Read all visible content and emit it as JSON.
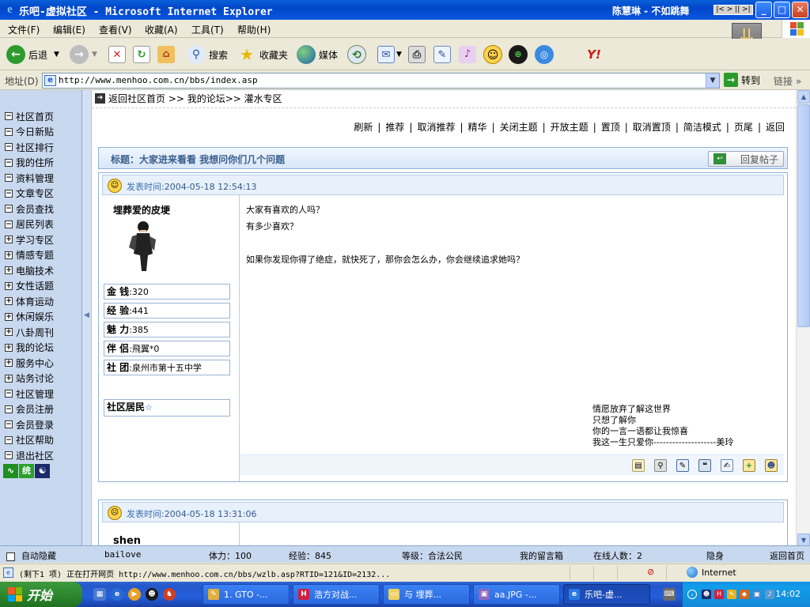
{
  "window": {
    "title": "乐吧-虚拟社区 - Microsoft Internet Explorer",
    "ticker": "陈慧琳 - 不如跳舞",
    "ticker_controls": "|< > || >|",
    "min": "_",
    "max": "□",
    "close": "✕"
  },
  "menu": [
    "文件(F)",
    "编辑(E)",
    "查看(V)",
    "收藏(A)",
    "工具(T)",
    "帮助(H)"
  ],
  "toolbar": {
    "back": "后退",
    "search": "搜索",
    "favorites": "收藏夹",
    "media": "媒体"
  },
  "address": {
    "label": "地址(D)",
    "url": "http://www.menhoo.com.cn/bbs/index.asp",
    "go": "转到",
    "links": "链接"
  },
  "sidebar": {
    "items": [
      {
        "label": "社区首页",
        "expander": "−"
      },
      {
        "label": "今日新贴",
        "expander": "−"
      },
      {
        "label": "社区排行",
        "expander": "−"
      },
      {
        "label": "我的住所",
        "expander": "−"
      },
      {
        "label": "资料管理",
        "expander": "−"
      },
      {
        "label": "文章专区",
        "expander": "−"
      },
      {
        "label": "会员查找",
        "expander": "−"
      },
      {
        "label": "居民列表",
        "expander": "−"
      },
      {
        "label": "学习专区",
        "expander": "+"
      },
      {
        "label": "情感专题",
        "expander": "+"
      },
      {
        "label": "电脑技术",
        "expander": "+"
      },
      {
        "label": "女性话题",
        "expander": "+"
      },
      {
        "label": "体育运动",
        "expander": "+"
      },
      {
        "label": "休闲娱乐",
        "expander": "+"
      },
      {
        "label": "八卦周刊",
        "expander": "+"
      },
      {
        "label": "我的论坛",
        "expander": "+"
      },
      {
        "label": "服务中心",
        "expander": "+"
      },
      {
        "label": "站务讨论",
        "expander": "+"
      },
      {
        "label": "社区管理",
        "expander": "−"
      },
      {
        "label": "会员注册",
        "expander": "−"
      },
      {
        "label": "会员登录",
        "expander": "−"
      },
      {
        "label": "社区帮助",
        "expander": "−"
      },
      {
        "label": "退出社区",
        "expander": "−"
      }
    ],
    "stat_icon_2": "统"
  },
  "breadcrumb": "返回社区首页 >> 我的论坛>> 灌水专区",
  "actions": [
    "刷新",
    "推荐",
    "取消推荐",
    "精华",
    "关闭主题",
    "开放主题",
    "置顶",
    "取消置顶",
    "简洁模式",
    "页尾",
    "返回"
  ],
  "topic": {
    "title": "标题：大家进来看看 我想问你们几个问题",
    "reply": "回复帖子"
  },
  "post1": {
    "time_label": "发表时间",
    "time": "2004-05-18 12:54:13",
    "username": "埋葬爱的皮埂",
    "stats": [
      {
        "k": "金 钱",
        "v": "320"
      },
      {
        "k": "经 验",
        "v": "441"
      },
      {
        "k": "魅 力",
        "v": "385"
      },
      {
        "k": "伴 侣",
        "v": "飛翼*0"
      },
      {
        "k": "社 团",
        "v": "泉州市第十五中学"
      }
    ],
    "rank": "社区居民",
    "body": [
      "大家有喜欢的人吗？",
      "有多少喜欢？",
      "",
      "如果你发现你得了绝症，就快死了，那你会怎么办，你会继续追求她吗？"
    ],
    "signature": [
      "情愿放弃了解这世界",
      "只想了解你",
      "你的一言一语都让我惊喜",
      "我这一生只爱你--------------------美玲"
    ]
  },
  "post2": {
    "time_label": "发表时间",
    "time": "2004-05-18 13:31:06",
    "username": "shen"
  },
  "forum_status": {
    "auto_hide": "自动隐藏",
    "user": "bailove",
    "stamina": "体力：100",
    "exp": "经验：845",
    "level": "等级：合法公民",
    "guestbook": "我的留言箱",
    "online": "在线人数：2",
    "hidden": "隐身",
    "home": "返回首页"
  },
  "statusbar": {
    "text": "(剩下1 项) 正在打开网页 http://www.menhoo.com.cn/bbs/wzlb.asp?RTID=121&ID=2132...",
    "zone": "Internet"
  },
  "taskbar": {
    "start": "开始",
    "tasks": [
      "1. GTO -...",
      "浩方对战...",
      "与 埋葬...",
      "aa.JPG -...",
      "乐吧-虚..."
    ],
    "clock": "14:02"
  },
  "colors": {
    "accent": "#0b56e0",
    "sidebar": "#c8d8ee",
    "topic_title": "#3a5f8c"
  }
}
